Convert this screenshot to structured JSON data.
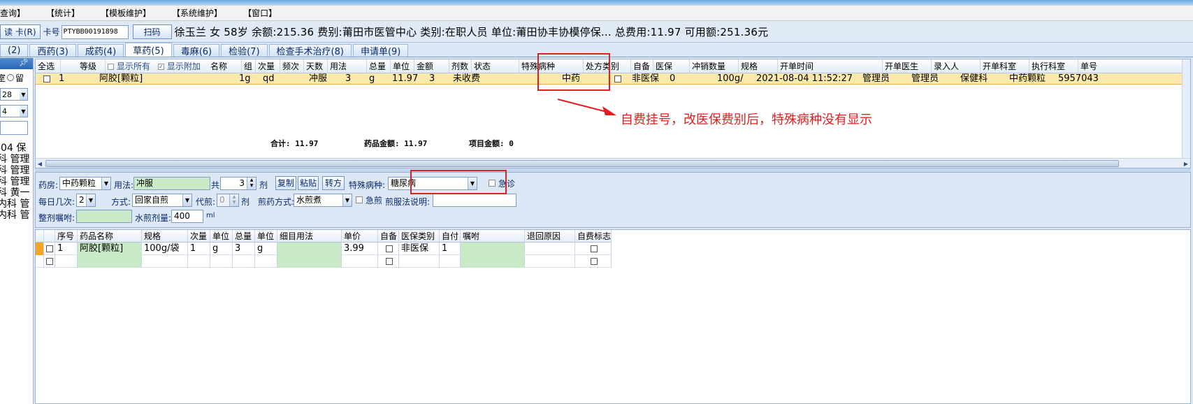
{
  "menu": [
    "查询】",
    "【统计】",
    "【模板维护】",
    "【系统维护】",
    "【窗口】"
  ],
  "infobar": {
    "read_card_btn": "读 卡(R)",
    "card_label": "卡号",
    "card_no": "PTYBB00191898",
    "scan_btn": "扫码",
    "patient_text": "徐玉兰  女  58岁  余额:215.36  费别:莆田市医管中心  类别:在职人员  单位:莆田协丰协模停保...  总费用:11.97  可用额:251.36元"
  },
  "tabs": [
    "(2)",
    "西药(3)",
    "成药(4)",
    "草药(5)",
    "毒麻(6)",
    "检验(7)",
    "检查手术治疗(8)",
    "申请单(9)"
  ],
  "active_tab_index": 3,
  "left_panel": {
    "pin_icon": "pin-icon",
    "radio_text": "室",
    "radio_label": "留",
    "combo1": "28",
    "combo2": "4",
    "list": [
      "-04 保",
      "科 管理",
      "科 管理",
      "科 管理",
      "科 黄一",
      "内科 管",
      "内科 管"
    ]
  },
  "grid1": {
    "headers": {
      "select_all": "全选",
      "level": "等级",
      "show_all": "显示所有",
      "show_extra": "显示附加",
      "name": "名称",
      "group": "组",
      "dose": "次量",
      "freq": "频次",
      "days": "天数",
      "usage": "用法",
      "total": "总量",
      "unit": "单位",
      "amount": "金额",
      "doses": "剂数",
      "status": "状态",
      "special_disease": "特殊病种",
      "rx_type": "处方类别",
      "self_prep": "自备",
      "insurance": "医保",
      "offset_qty": "冲销数量",
      "spec": "规格",
      "order_time": "开单时间",
      "order_doctor": "开单医生",
      "entry_person": "录入人",
      "order_dept": "开单科室",
      "exec_dept": "执行科室",
      "order_no": "单号"
    },
    "row": {
      "seq": "1",
      "drug": "阿胶[颗粒]",
      "dose": "1g",
      "freq": "qd",
      "usage": "冲服",
      "total": "3",
      "unit": "g",
      "amount": "11.97",
      "doses": "3",
      "status": "未收费",
      "special_disease": "",
      "rx_type": "中药",
      "insurance": "非医保",
      "offset_qty": "0",
      "spec": "100g/",
      "order_time": "2021-08-04 11:52:27",
      "order_doctor": "管理员",
      "entry_person": "管理员",
      "order_dept": "保健科",
      "exec_dept": "中药颗粒",
      "order_no": "5957043"
    },
    "totals": {
      "sum": "合计:  11.97",
      "drug_amount": "药品金额:  11.97",
      "item_amount": "项目金额:  0"
    }
  },
  "annotation": "自费挂号，改医保费别后，特殊病种没有显示",
  "form": {
    "pharmacy_label": "药房:",
    "pharmacy": "中药颗粒",
    "usage_label": "用法:",
    "usage": "冲服",
    "total_label": "共",
    "total_doses": "3",
    "doses_unit": "剂",
    "copy_btn": "复制",
    "paste_btn": "粘贴",
    "convert_btn": "转方",
    "special_disease_label": "特殊病种:",
    "special_disease": "糖尿病",
    "urgent_label": "急诊",
    "daily_times_label": "每日几次:",
    "daily_times": "2",
    "method_label": "方式:",
    "method": "回家自煎",
    "substitute_label": "代煎:",
    "substitute_value": "0",
    "substitute_unit": "剂",
    "decoct_label": "煎药方式:",
    "decoct": "水煎煮",
    "urgent_decoct_label": "急煎",
    "decoct_note_label": "煎服法说明:",
    "decoct_note": "",
    "whole_note_label": "整剂嘱咐:",
    "whole_note": "",
    "water_label": "水煎剂量:",
    "water": "400",
    "water_unit": "ml"
  },
  "grid2": {
    "headers": [
      "序号",
      "药品名称",
      "规格",
      "次量",
      "单位",
      "总量",
      "单位",
      "细目用法",
      "单价",
      "自备",
      "医保类别",
      "自付",
      "嘱咐",
      "退回原因",
      "自费标志"
    ],
    "rows": [
      {
        "seq": "1",
        "name": "阿胶[颗粒]",
        "spec": "100g/袋",
        "dose": "1",
        "unit": "g",
        "total": "3",
        "unit2": "g",
        "detail": "",
        "price": "3.99",
        "ins": "非医保",
        "selfpay": "1",
        "note": "",
        "reason": ""
      },
      {
        "seq": "",
        "name": "",
        "spec": "",
        "dose": "",
        "unit": "",
        "total": "",
        "unit2": "",
        "detail": "",
        "price": "",
        "ins": "",
        "selfpay": "",
        "note": "",
        "reason": ""
      }
    ]
  },
  "colors": {
    "selected_row": "#fde9a9",
    "annotation_red": "#e02020",
    "tab_blue": "#0b2a6b",
    "green_cell": "#c9eac6"
  }
}
